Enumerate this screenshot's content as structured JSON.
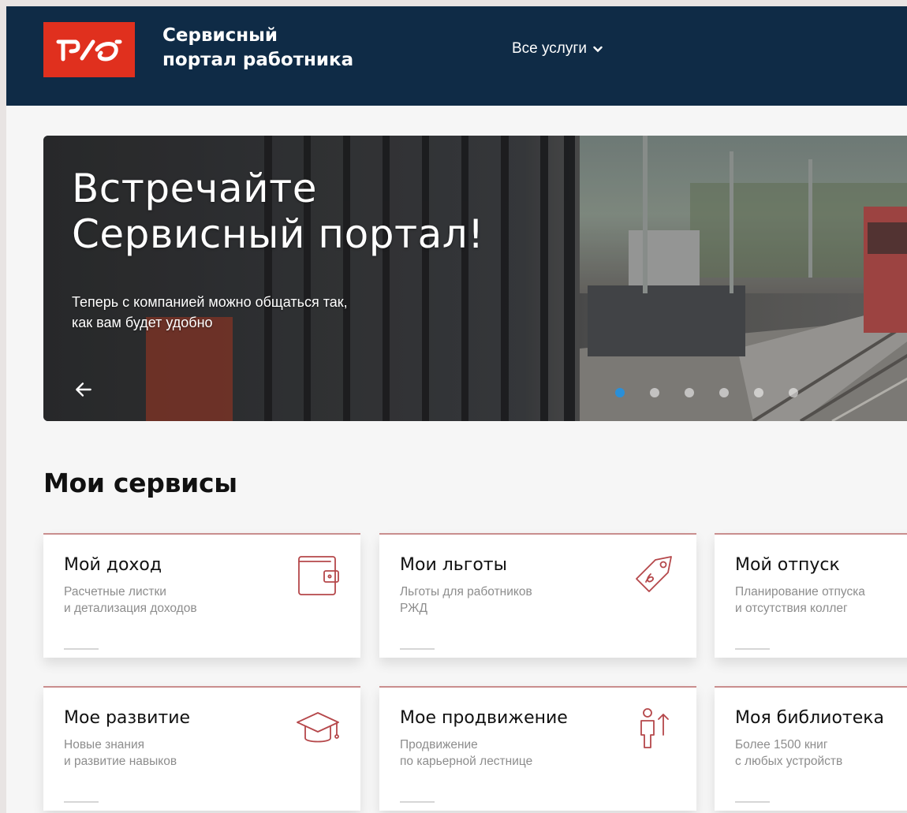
{
  "header": {
    "logo_text": "РЖД",
    "brand_line1": "Сервисный",
    "brand_line2": "портал работника",
    "menu_label": "Все услуги"
  },
  "banner": {
    "title_line1": "Встречайте",
    "title_line2": "Сервисный портал!",
    "subtitle_line1": "Теперь с компанией можно общаться так,",
    "subtitle_line2": "как вам будет удобно",
    "slides_total": 6,
    "active_slide": 1
  },
  "services": {
    "title": "Мои сервисы",
    "cards": [
      {
        "title": "Мой доход",
        "desc1": "Расчетные листки",
        "desc2": "и детализация доходов",
        "icon": "wallet-icon"
      },
      {
        "title": "Мои льготы",
        "desc1": "Льготы для работников",
        "desc2": "РЖД",
        "icon": "tag-icon"
      },
      {
        "title": "Мой отпуск",
        "desc1": "Планирование отпуска",
        "desc2": "и отсутствия коллег",
        "icon": "vacation-icon"
      },
      {
        "title": "Мое развитие",
        "desc1": "Новые знания",
        "desc2": "и развитие навыков",
        "icon": "graduation-cap-icon"
      },
      {
        "title": "Мое продвижение",
        "desc1": "Продвижение",
        "desc2": "по карьерной лестнице",
        "icon": "career-up-icon"
      },
      {
        "title": "Моя библиотека",
        "desc1": "Более 1500 книг",
        "desc2": "с любых устройств",
        "icon": "book-icon"
      }
    ]
  },
  "colors": {
    "header_bg": "#0f2b46",
    "logo_red": "#e0301e",
    "accent_line": "#c98e8e",
    "icon_stroke": "#b5474a",
    "dot_active": "#2a8fd8"
  }
}
